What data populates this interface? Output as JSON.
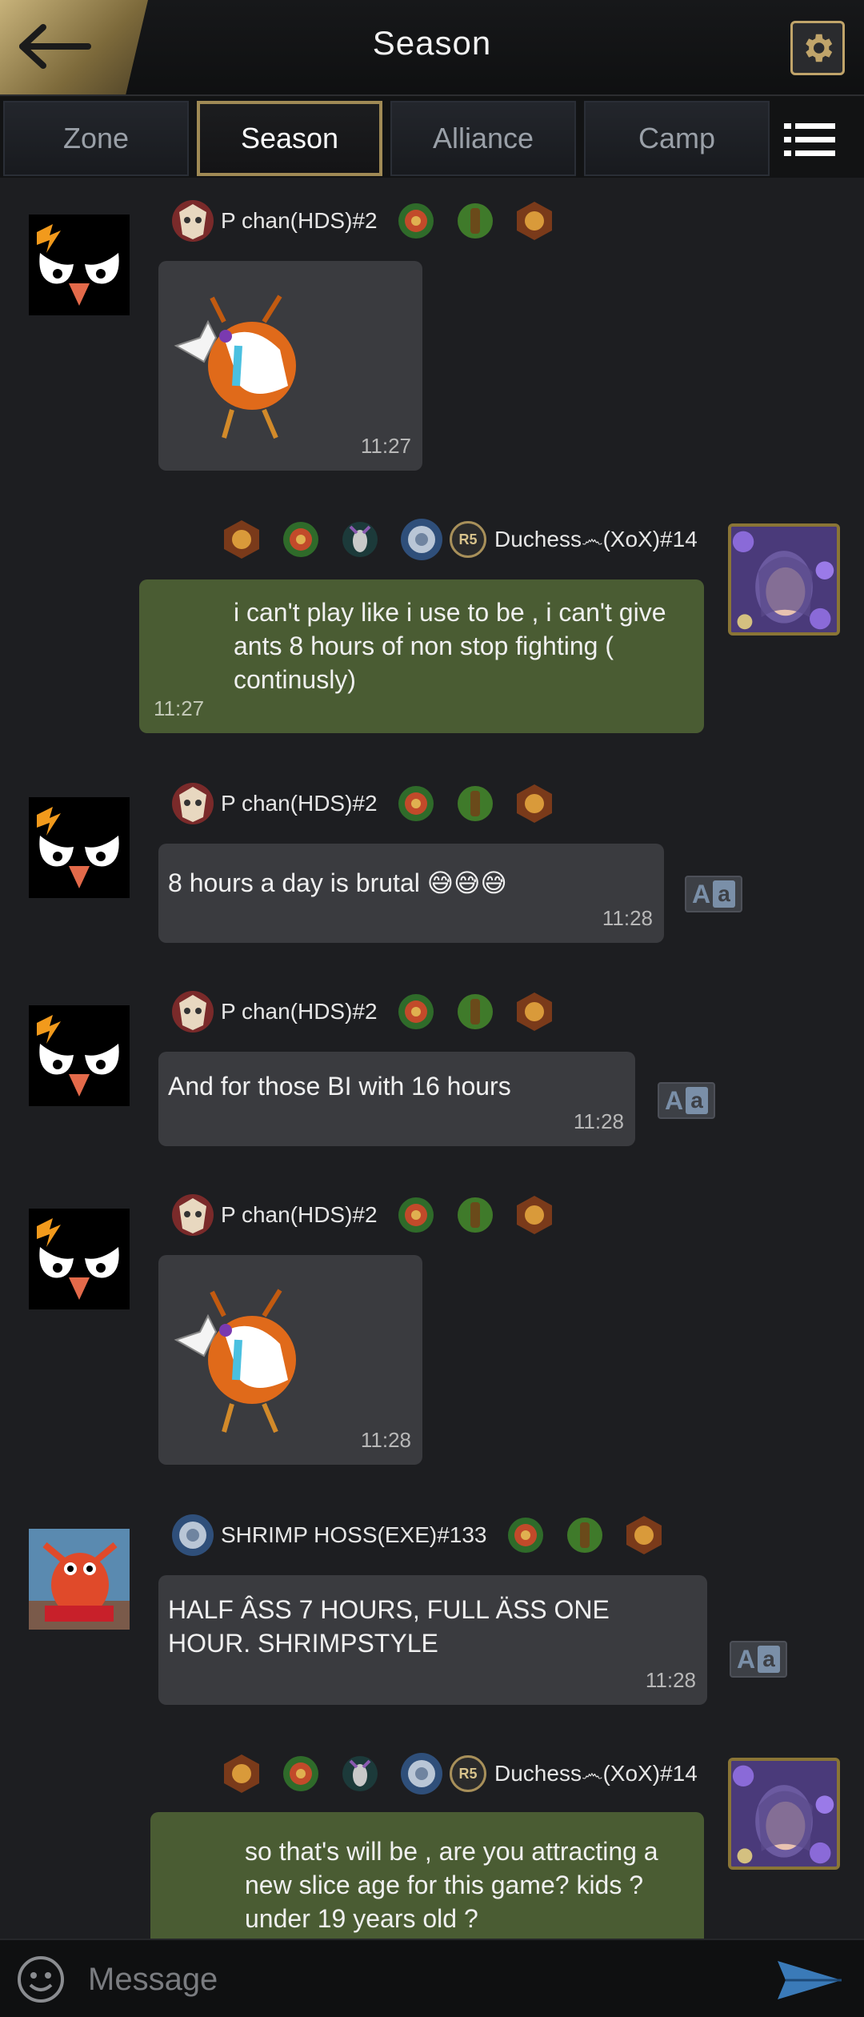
{
  "header": {
    "title": "Season",
    "back_icon": "back-arrow-icon",
    "settings_icon": "gear-icon"
  },
  "tabs": [
    {
      "label": "Zone",
      "active": false
    },
    {
      "label": "Season",
      "active": true
    },
    {
      "label": "Alliance",
      "active": false
    },
    {
      "label": "Camp",
      "active": false
    }
  ],
  "menu_icon": "list-menu-icon",
  "messages": [
    {
      "sender": "P chan(HDS)#2",
      "time": "11:27",
      "type": "sticker",
      "side": "left"
    },
    {
      "sender": "Duchess෴(XoX)#14",
      "rank": "R5",
      "time": "11:27",
      "side": "right",
      "text": "i can't play like i use to be , i can't give ants 8 hours of non stop fighting ( continusly)"
    },
    {
      "sender": "P chan(HDS)#2",
      "time": "11:28",
      "side": "left",
      "text": "8 hours a day is brutal 😅😅😅"
    },
    {
      "sender": "P chan(HDS)#2",
      "time": "11:28",
      "side": "left",
      "text": "And for those BI with 16 hours"
    },
    {
      "sender": "P chan(HDS)#2",
      "time": "11:28",
      "type": "sticker",
      "side": "left"
    },
    {
      "sender": "SHRIMP HOSS(EXE)#133",
      "time": "11:28",
      "side": "left",
      "text": "HALF ÂSS 7 HOURS, FULL ÄSS ONE HOUR. SHRIMPSTYLE"
    },
    {
      "sender": "Duchess෴(XoX)#14",
      "rank": "R5",
      "side": "right",
      "text": "so that's will be , are you attracting a new slice age for this game? kids ? under 19 years old ?"
    }
  ],
  "translate_label": {
    "a1": "A",
    "a2": "a"
  },
  "input": {
    "placeholder": "Message"
  },
  "colors": {
    "accent_gold": "#a08a55",
    "own_bubble": "#4a5c33",
    "other_bubble": "#3a3b3f"
  }
}
